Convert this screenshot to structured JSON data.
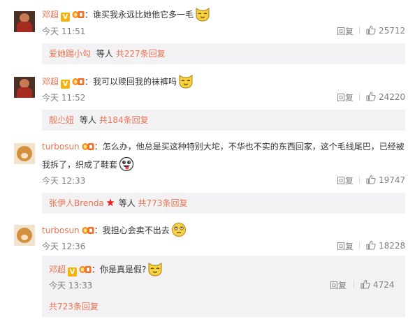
{
  "comments": [
    {
      "author": "邓超",
      "text": "谁买我永远比她他它多一毛",
      "time": "今天 11:51",
      "reply_label": "回复",
      "likes": "25712",
      "sub_author": "爱她踢小勾",
      "sub_middle": "等人",
      "sub_count": "共227条回复"
    },
    {
      "author": "邓超",
      "text": "我可以赎回我的袜裤吗",
      "time": "今天 11:52",
      "reply_label": "回复",
      "likes": "24220",
      "sub_author": "靓尐妞",
      "sub_middle": "等人",
      "sub_count": "共184条回复"
    },
    {
      "author": "turbosun",
      "text_line1": "怎么办，他总是买这种特别大坨，不华也不实的东西回家，这个毛线尾巴，已经被",
      "text_line2": "我拆了，织成了鞋套",
      "time": "今天 12:33",
      "reply_label": "回复",
      "likes": "19747",
      "sub_author": "张伊人Brenda",
      "sub_middle": "等人",
      "sub_count": "共773条回复"
    },
    {
      "author": "turbosun",
      "text": "我担心会卖不出去",
      "time": "今天 12:36",
      "reply_label": "回复",
      "likes": "18228",
      "nested": {
        "author": "邓超",
        "text": "你是真是假?",
        "time": "今天 13:33",
        "reply_label": "回复",
        "likes": "4724",
        "total": "共723条回复"
      }
    }
  ],
  "colors": {
    "username": "#eb7350",
    "meta": "#808080",
    "subbox_bg": "#f2f2f5"
  }
}
